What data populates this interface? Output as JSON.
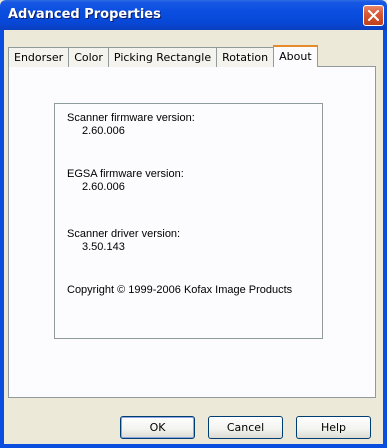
{
  "window": {
    "title": "Advanced Properties"
  },
  "tabs": [
    {
      "label": "Endorser"
    },
    {
      "label": "Color"
    },
    {
      "label": "Picking Rectangle"
    },
    {
      "label": "Rotation"
    },
    {
      "label": "About"
    }
  ],
  "active_tab": "About",
  "about": {
    "scanner_firmware_label": "Scanner firmware version:",
    "scanner_firmware_value": "2.60.006",
    "egsa_firmware_label": "EGSA firmware version:",
    "egsa_firmware_value": "2.60.006",
    "driver_label": "Scanner driver version:",
    "driver_value": "3.50.143",
    "copyright": "Copyright © 1999-2006 Kofax Image Products"
  },
  "buttons": {
    "ok": "OK",
    "cancel": "Cancel",
    "help": "Help"
  },
  "colors": {
    "titlebar": "#0a4ee0",
    "close": "#c0401d",
    "active_tab_accent": "#e68b2c"
  }
}
